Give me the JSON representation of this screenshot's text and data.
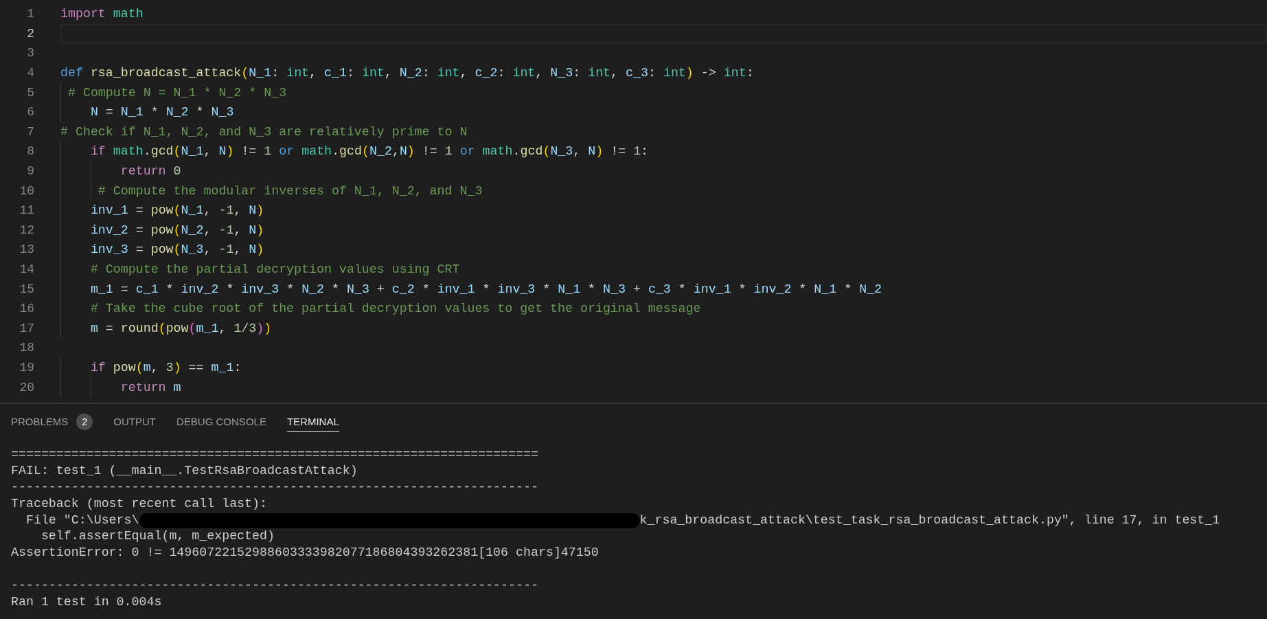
{
  "editor": {
    "lines": [
      {
        "number": "1",
        "current": false,
        "tokens": [
          {
            "text": "import",
            "kind": "kw"
          },
          {
            "text": " math",
            "kind": "type"
          }
        ]
      },
      {
        "number": "2",
        "current": true
      },
      {
        "number": "3",
        "current": false
      },
      {
        "number": "4",
        "current": false,
        "tokens": [
          {
            "text": "def",
            "kind": "def"
          },
          {
            "text": " rsa_broadcast_attack",
            "kind": "fn"
          },
          {
            "text": "(",
            "kind": "b1"
          },
          {
            "text": "N_1",
            "kind": "var"
          },
          {
            "text": ": ",
            "kind": "p"
          },
          {
            "text": "int",
            "kind": "type"
          },
          {
            "text": ", ",
            "kind": "p"
          },
          {
            "text": "c_1",
            "kind": "var"
          },
          {
            "text": ": ",
            "kind": "p"
          },
          {
            "text": "int",
            "kind": "type"
          },
          {
            "text": ", ",
            "kind": "p"
          },
          {
            "text": "N_2",
            "kind": "var"
          },
          {
            "text": ": ",
            "kind": "p"
          },
          {
            "text": "int",
            "kind": "type"
          },
          {
            "text": ", ",
            "kind": "p"
          },
          {
            "text": "c_2",
            "kind": "var"
          },
          {
            "text": ": ",
            "kind": "p"
          },
          {
            "text": "int",
            "kind": "type"
          },
          {
            "text": ", ",
            "kind": "p"
          },
          {
            "text": "N_3",
            "kind": "var"
          },
          {
            "text": ": ",
            "kind": "p"
          },
          {
            "text": "int",
            "kind": "type"
          },
          {
            "text": ", ",
            "kind": "p"
          },
          {
            "text": "c_3",
            "kind": "var"
          },
          {
            "text": ": ",
            "kind": "p"
          },
          {
            "text": "int",
            "kind": "type"
          },
          {
            "text": ")",
            "kind": "b1"
          },
          {
            "text": " -> ",
            "kind": "p"
          },
          {
            "text": "int",
            "kind": "type"
          },
          {
            "text": ":",
            "kind": "p"
          }
        ]
      },
      {
        "number": "5",
        "current": false,
        "tokens": [
          {
            "text": " # Compute N = N_1 * N_2 * N_3",
            "kind": "cm"
          }
        ]
      },
      {
        "number": "6",
        "current": false,
        "tokens": [
          {
            "text": "    N",
            "kind": "var"
          },
          {
            "text": " = ",
            "kind": "p"
          },
          {
            "text": "N_1",
            "kind": "var"
          },
          {
            "text": " * ",
            "kind": "p"
          },
          {
            "text": "N_2",
            "kind": "var"
          },
          {
            "text": " * ",
            "kind": "p"
          },
          {
            "text": "N_3",
            "kind": "var"
          }
        ]
      },
      {
        "number": "7",
        "current": false,
        "tokens": [
          {
            "text": "# Check if N_1, N_2, and N_3 are relatively prime to N",
            "kind": "cm"
          }
        ]
      },
      {
        "number": "8",
        "current": false,
        "tokens": [
          {
            "text": "    if",
            "kind": "kw"
          },
          {
            "text": " math",
            "kind": "type"
          },
          {
            "text": ".",
            "kind": "p"
          },
          {
            "text": "gcd",
            "kind": "fn"
          },
          {
            "text": "(",
            "kind": "b1"
          },
          {
            "text": "N_1",
            "kind": "var"
          },
          {
            "text": ", ",
            "kind": "p"
          },
          {
            "text": "N",
            "kind": "var"
          },
          {
            "text": ")",
            "kind": "b1"
          },
          {
            "text": " != ",
            "kind": "p"
          },
          {
            "text": "1",
            "kind": "num"
          },
          {
            "text": " or",
            "kind": "def"
          },
          {
            "text": " math",
            "kind": "type"
          },
          {
            "text": ".",
            "kind": "p"
          },
          {
            "text": "gcd",
            "kind": "fn"
          },
          {
            "text": "(",
            "kind": "b1"
          },
          {
            "text": "N_2",
            "kind": "var"
          },
          {
            "text": ",",
            "kind": "p"
          },
          {
            "text": "N",
            "kind": "var"
          },
          {
            "text": ")",
            "kind": "b1"
          },
          {
            "text": " != ",
            "kind": "p"
          },
          {
            "text": "1",
            "kind": "num"
          },
          {
            "text": " or",
            "kind": "def"
          },
          {
            "text": " math",
            "kind": "type"
          },
          {
            "text": ".",
            "kind": "p"
          },
          {
            "text": "gcd",
            "kind": "fn"
          },
          {
            "text": "(",
            "kind": "b1"
          },
          {
            "text": "N_3",
            "kind": "var"
          },
          {
            "text": ", ",
            "kind": "p"
          },
          {
            "text": "N",
            "kind": "var"
          },
          {
            "text": ")",
            "kind": "b1"
          },
          {
            "text": " != ",
            "kind": "p"
          },
          {
            "text": "1",
            "kind": "num"
          },
          {
            "text": ":",
            "kind": "p"
          }
        ]
      },
      {
        "number": "9",
        "current": false,
        "tokens": [
          {
            "text": "        return",
            "kind": "kw"
          },
          {
            "text": " 0",
            "kind": "num"
          }
        ]
      },
      {
        "number": "10",
        "current": false,
        "tokens": [
          {
            "text": "     # Compute the modular inverses of N_1, N_2, and N_3",
            "kind": "cm"
          }
        ]
      },
      {
        "number": "11",
        "current": false,
        "tokens": [
          {
            "text": "    inv_1",
            "kind": "var"
          },
          {
            "text": " = ",
            "kind": "p"
          },
          {
            "text": "pow",
            "kind": "fn"
          },
          {
            "text": "(",
            "kind": "b1"
          },
          {
            "text": "N_1",
            "kind": "var"
          },
          {
            "text": ", ",
            "kind": "p"
          },
          {
            "text": "-1",
            "kind": "num"
          },
          {
            "text": ", ",
            "kind": "p"
          },
          {
            "text": "N",
            "kind": "var"
          },
          {
            "text": ")",
            "kind": "b1"
          }
        ]
      },
      {
        "number": "12",
        "current": false,
        "tokens": [
          {
            "text": "    inv_2",
            "kind": "var"
          },
          {
            "text": " = ",
            "kind": "p"
          },
          {
            "text": "pow",
            "kind": "fn"
          },
          {
            "text": "(",
            "kind": "b1"
          },
          {
            "text": "N_2",
            "kind": "var"
          },
          {
            "text": ", ",
            "kind": "p"
          },
          {
            "text": "-1",
            "kind": "num"
          },
          {
            "text": ", ",
            "kind": "p"
          },
          {
            "text": "N",
            "kind": "var"
          },
          {
            "text": ")",
            "kind": "b1"
          }
        ]
      },
      {
        "number": "13",
        "current": false,
        "tokens": [
          {
            "text": "    inv_3",
            "kind": "var"
          },
          {
            "text": " = ",
            "kind": "p"
          },
          {
            "text": "pow",
            "kind": "fn"
          },
          {
            "text": "(",
            "kind": "b1"
          },
          {
            "text": "N_3",
            "kind": "var"
          },
          {
            "text": ", ",
            "kind": "p"
          },
          {
            "text": "-1",
            "kind": "num"
          },
          {
            "text": ", ",
            "kind": "p"
          },
          {
            "text": "N",
            "kind": "var"
          },
          {
            "text": ")",
            "kind": "b1"
          }
        ]
      },
      {
        "number": "14",
        "current": false,
        "tokens": [
          {
            "text": "    # Compute the partial decryption values using CRT",
            "kind": "cm"
          }
        ]
      },
      {
        "number": "15",
        "current": false,
        "tokens": [
          {
            "text": "    m_1",
            "kind": "var"
          },
          {
            "text": " = ",
            "kind": "p"
          },
          {
            "text": "c_1",
            "kind": "var"
          },
          {
            "text": " * ",
            "kind": "p"
          },
          {
            "text": "inv_2",
            "kind": "var"
          },
          {
            "text": " * ",
            "kind": "p"
          },
          {
            "text": "inv_3",
            "kind": "var"
          },
          {
            "text": " * ",
            "kind": "p"
          },
          {
            "text": "N_2",
            "kind": "var"
          },
          {
            "text": " * ",
            "kind": "p"
          },
          {
            "text": "N_3",
            "kind": "var"
          },
          {
            "text": " + ",
            "kind": "p"
          },
          {
            "text": "c_2",
            "kind": "var"
          },
          {
            "text": " * ",
            "kind": "p"
          },
          {
            "text": "inv_1",
            "kind": "var"
          },
          {
            "text": " * ",
            "kind": "p"
          },
          {
            "text": "inv_3",
            "kind": "var"
          },
          {
            "text": " * ",
            "kind": "p"
          },
          {
            "text": "N_1",
            "kind": "var"
          },
          {
            "text": " * ",
            "kind": "p"
          },
          {
            "text": "N_3",
            "kind": "var"
          },
          {
            "text": " + ",
            "kind": "p"
          },
          {
            "text": "c_3",
            "kind": "var"
          },
          {
            "text": " * ",
            "kind": "p"
          },
          {
            "text": "inv_1",
            "kind": "var"
          },
          {
            "text": " * ",
            "kind": "p"
          },
          {
            "text": "inv_2",
            "kind": "var"
          },
          {
            "text": " * ",
            "kind": "p"
          },
          {
            "text": "N_1",
            "kind": "var"
          },
          {
            "text": " * ",
            "kind": "p"
          },
          {
            "text": "N_2",
            "kind": "var"
          }
        ]
      },
      {
        "number": "16",
        "current": false,
        "tokens": [
          {
            "text": "    # Take the cube root of the partial decryption values to get the original message",
            "kind": "cm"
          }
        ]
      },
      {
        "number": "17",
        "current": false,
        "tokens": [
          {
            "text": "    m",
            "kind": "var"
          },
          {
            "text": " = ",
            "kind": "p"
          },
          {
            "text": "round",
            "kind": "fn"
          },
          {
            "text": "(",
            "kind": "b1"
          },
          {
            "text": "pow",
            "kind": "fn"
          },
          {
            "text": "(",
            "kind": "b2"
          },
          {
            "text": "m_1",
            "kind": "var"
          },
          {
            "text": ", ",
            "kind": "p"
          },
          {
            "text": "1/3",
            "kind": "num"
          },
          {
            "text": ")",
            "kind": "b2"
          },
          {
            "text": ")",
            "kind": "b1"
          }
        ]
      },
      {
        "number": "18",
        "current": false
      },
      {
        "number": "19",
        "current": false,
        "tokens": [
          {
            "text": "    if",
            "kind": "kw"
          },
          {
            "text": " pow",
            "kind": "fn"
          },
          {
            "text": "(",
            "kind": "b1"
          },
          {
            "text": "m",
            "kind": "var"
          },
          {
            "text": ", ",
            "kind": "p"
          },
          {
            "text": "3",
            "kind": "num"
          },
          {
            "text": ")",
            "kind": "b1"
          },
          {
            "text": " == ",
            "kind": "p"
          },
          {
            "text": "m_1",
            "kind": "var"
          },
          {
            "text": ":",
            "kind": "p"
          }
        ]
      },
      {
        "number": "20",
        "current": false,
        "tokens": [
          {
            "text": "        return",
            "kind": "kw"
          },
          {
            "text": " m",
            "kind": "var"
          }
        ]
      }
    ]
  },
  "panel": {
    "tabs": [
      {
        "label": "PROBLEMS",
        "badge": "2",
        "selected": false
      },
      {
        "label": "OUTPUT",
        "selected": false
      },
      {
        "label": "DEBUG CONSOLE",
        "selected": false
      },
      {
        "label": "TERMINAL",
        "selected": true
      }
    ],
    "terminal": [
      {
        "kind": "text",
        "text": "======================================================================"
      },
      {
        "kind": "text",
        "text": "FAIL: test_1 (__main__.TestRsaBroadcastAttack)"
      },
      {
        "kind": "text",
        "text": "----------------------------------------------------------------------"
      },
      {
        "kind": "text",
        "text": "Traceback (most recent call last):"
      },
      {
        "kind": "redacted",
        "before": "  File \"C:\\Users\\",
        "after": "k_rsa_broadcast_attack\\test_task_rsa_broadcast_attack.py\", line 17, in test_1"
      },
      {
        "kind": "text",
        "text": "    self.assertEqual(m, m_expected)"
      },
      {
        "kind": "text",
        "text": "AssertionError: 0 != 14960722152988603333982077186804393262381[106 chars]47150"
      },
      {
        "kind": "blank"
      },
      {
        "kind": "text",
        "text": "----------------------------------------------------------------------"
      },
      {
        "kind": "text",
        "text": "Ran 1 test in 0.004s"
      }
    ]
  }
}
